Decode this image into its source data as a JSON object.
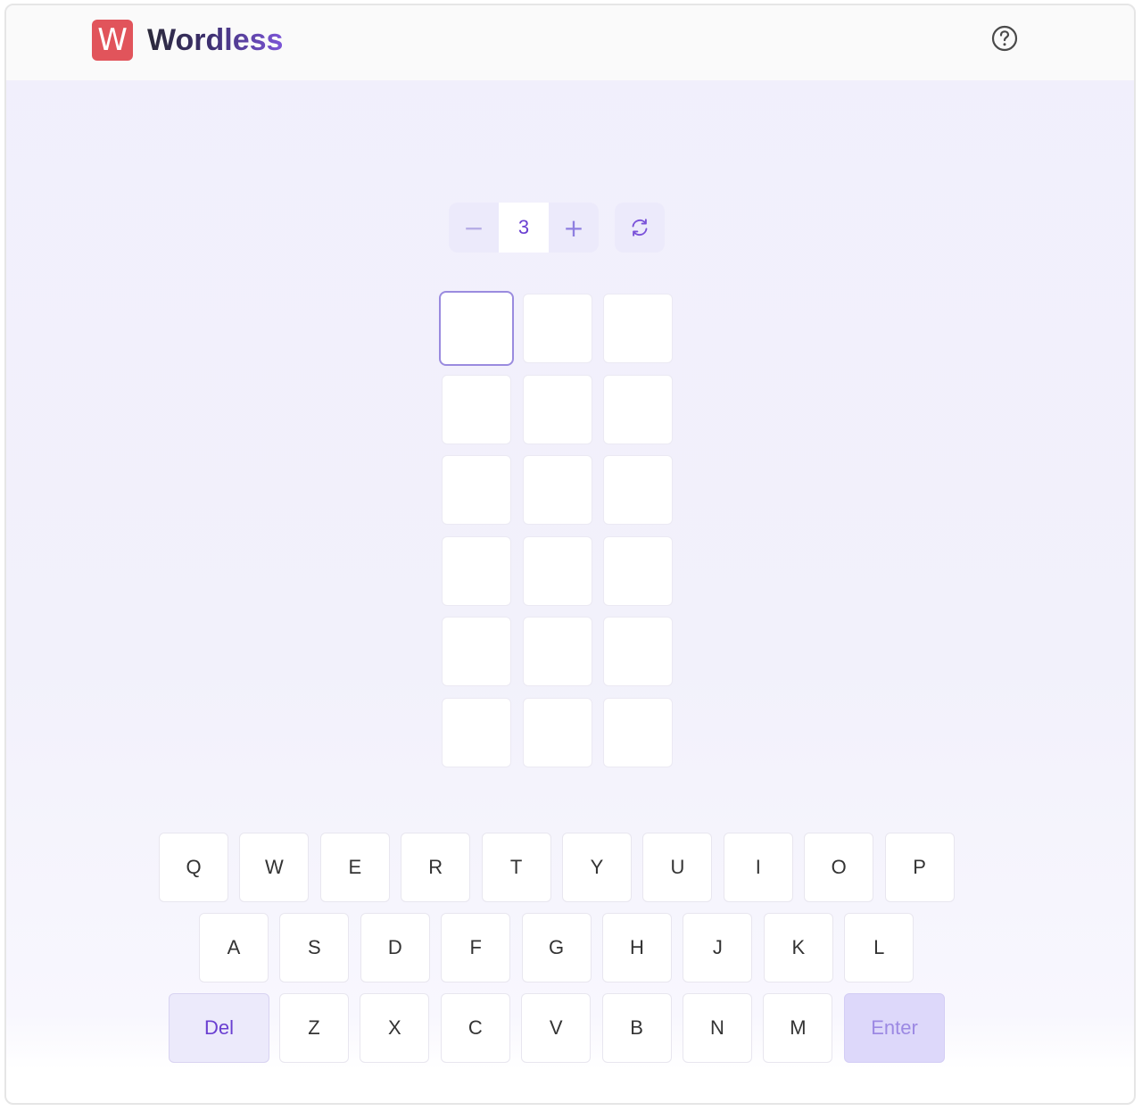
{
  "app": {
    "logo_letter": "W",
    "title": "Wordless"
  },
  "controls": {
    "minus_label": "−",
    "length_value": "3",
    "plus_label": "+"
  },
  "board": {
    "rows": 6,
    "cols": 3,
    "active_cell": [
      0,
      0
    ]
  },
  "keyboard": {
    "row1": [
      "Q",
      "W",
      "E",
      "R",
      "T",
      "Y",
      "U",
      "I",
      "O",
      "P"
    ],
    "row2": [
      "A",
      "S",
      "D",
      "F",
      "G",
      "H",
      "J",
      "K",
      "L"
    ],
    "row3": [
      "Z",
      "X",
      "C",
      "V",
      "B",
      "N",
      "M"
    ],
    "del_label": "Del",
    "enter_label": "Enter"
  },
  "colors": {
    "logo_red": "#e1545b",
    "accent_purple": "#6a3fd1",
    "enter_bg": "#ddd8fa"
  }
}
